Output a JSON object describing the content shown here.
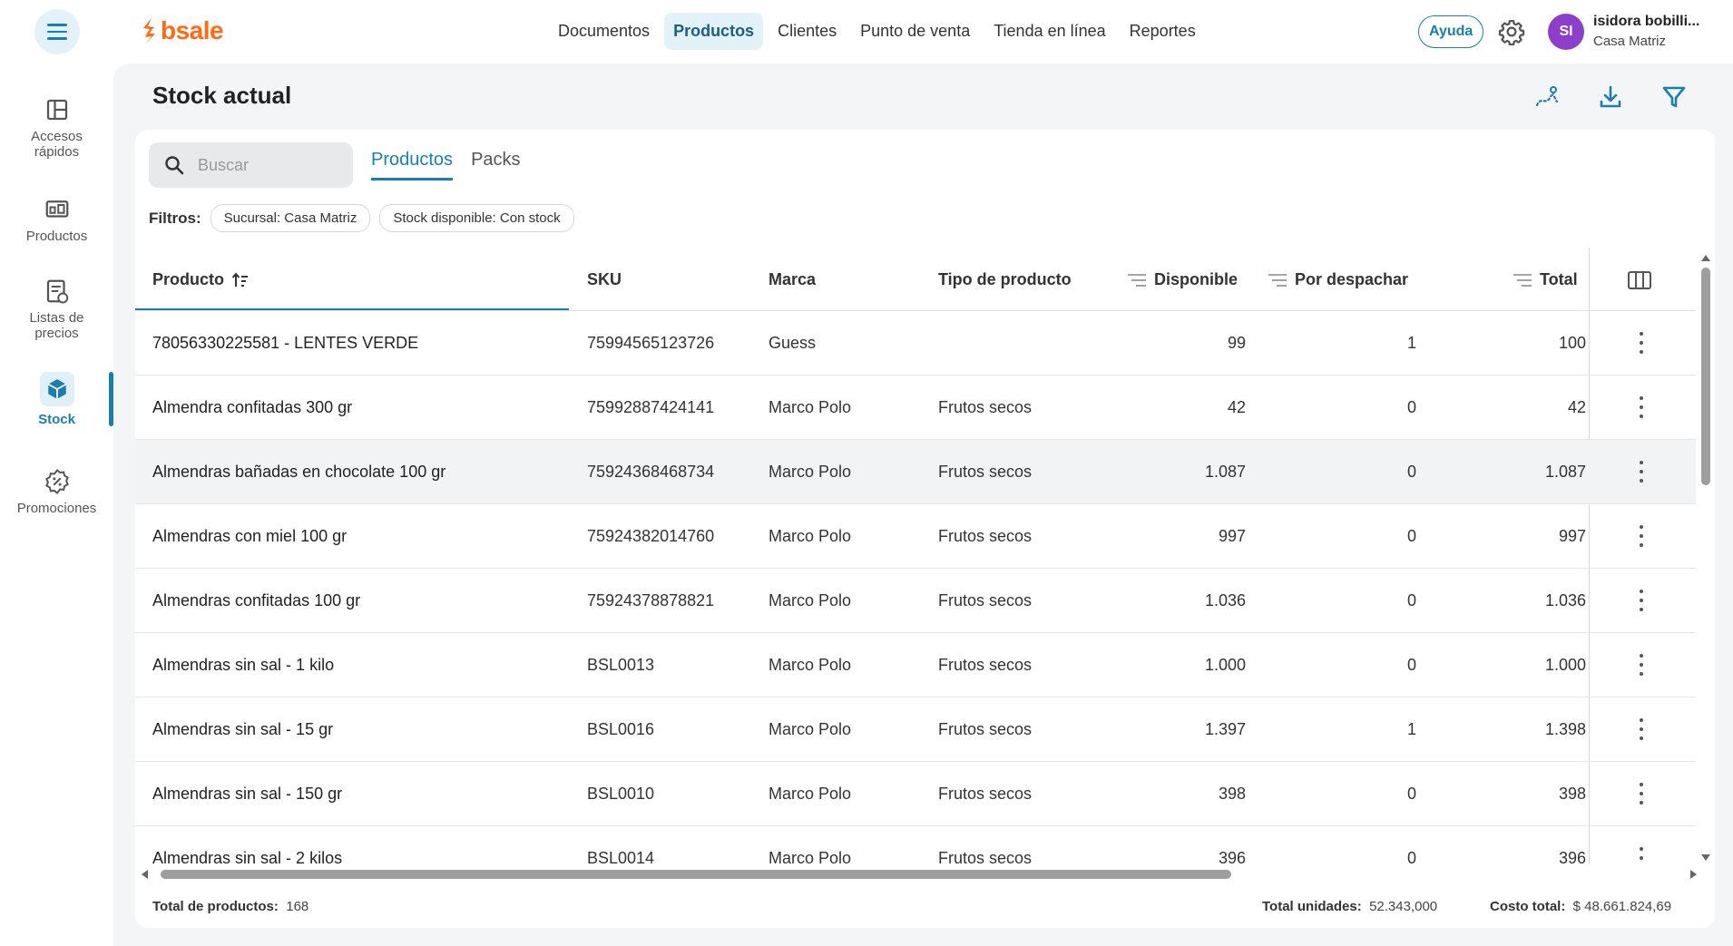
{
  "brand": {
    "name": "bsale",
    "color": "#ff6a13",
    "accent": "#1a7fb0"
  },
  "topnav": {
    "items": [
      {
        "label": "Documentos",
        "active": false
      },
      {
        "label": "Productos",
        "active": true
      },
      {
        "label": "Clientes",
        "active": false
      },
      {
        "label": "Punto de venta",
        "active": false
      },
      {
        "label": "Tienda en línea",
        "active": false
      },
      {
        "label": "Reportes",
        "active": false
      }
    ],
    "help_label": "Ayuda",
    "user_initials": "SI",
    "user_name": "isidora bobilli...",
    "user_branch": "Casa Matriz"
  },
  "sidebar": {
    "items": [
      {
        "label": "Accesos rápidos",
        "icon": "layout-grid-icon"
      },
      {
        "label": "Productos",
        "icon": "products-icon"
      },
      {
        "label": "Listas de precios",
        "icon": "price-list-icon"
      },
      {
        "label": "Stock",
        "icon": "cube-icon",
        "active": true
      },
      {
        "label": "Promociones",
        "icon": "discount-badge-icon"
      }
    ]
  },
  "page": {
    "title": "Stock actual",
    "search_placeholder": "Buscar",
    "tabs": [
      {
        "label": "Productos",
        "active": true
      },
      {
        "label": "Packs",
        "active": false
      }
    ],
    "filters_label": "Filtros:",
    "filters": [
      "Sucursal: Casa Matriz",
      "Stock disponible: Con stock"
    ]
  },
  "table": {
    "columns": {
      "producto": "Producto",
      "sku": "SKU",
      "marca": "Marca",
      "tipo": "Tipo de producto",
      "disponible": "Disponible",
      "por_despachar": "Por despachar",
      "total": "Total"
    },
    "rows": [
      {
        "producto": "78056330225581 - LENTES VERDE",
        "sku": "75994565123726",
        "marca": "Guess",
        "tipo": "",
        "disponible": "99",
        "por_despachar": "1",
        "total": "100"
      },
      {
        "producto": "Almendra confitadas 300 gr",
        "sku": "75992887424141",
        "marca": "Marco Polo",
        "tipo": "Frutos secos",
        "disponible": "42",
        "por_despachar": "0",
        "total": "42"
      },
      {
        "producto": "Almendras bañadas en chocolate 100 gr",
        "sku": "75924368468734",
        "marca": "Marco Polo",
        "tipo": "Frutos secos",
        "disponible": "1.087",
        "por_despachar": "0",
        "total": "1.087"
      },
      {
        "producto": "Almendras con miel 100 gr",
        "sku": "75924382014760",
        "marca": "Marco Polo",
        "tipo": "Frutos secos",
        "disponible": "997",
        "por_despachar": "0",
        "total": "997"
      },
      {
        "producto": "Almendras confitadas 100 gr",
        "sku": "75924378878821",
        "marca": "Marco Polo",
        "tipo": "Frutos secos",
        "disponible": "1.036",
        "por_despachar": "0",
        "total": "1.036"
      },
      {
        "producto": "Almendras sin sal - 1 kilo",
        "sku": "BSL0013",
        "marca": "Marco Polo",
        "tipo": "Frutos secos",
        "disponible": "1.000",
        "por_despachar": "0",
        "total": "1.000"
      },
      {
        "producto": "Almendras sin sal - 15 gr",
        "sku": "BSL0016",
        "marca": "Marco Polo",
        "tipo": "Frutos secos",
        "disponible": "1.397",
        "por_despachar": "1",
        "total": "1.398"
      },
      {
        "producto": "Almendras sin sal - 150 gr",
        "sku": "BSL0010",
        "marca": "Marco Polo",
        "tipo": "Frutos secos",
        "disponible": "398",
        "por_despachar": "0",
        "total": "398"
      },
      {
        "producto": "Almendras sin sal - 2 kilos",
        "sku": "BSL0014",
        "marca": "Marco Polo",
        "tipo": "Frutos secos",
        "disponible": "396",
        "por_despachar": "0",
        "total": "396"
      }
    ]
  },
  "footer": {
    "total_productos_label": "Total de productos:",
    "total_productos": "168",
    "total_unidades_label": "Total unidades:",
    "total_unidades": "52.343,000",
    "costo_total_label": "Costo total:",
    "costo_total": "$ 48.661.824,69"
  }
}
